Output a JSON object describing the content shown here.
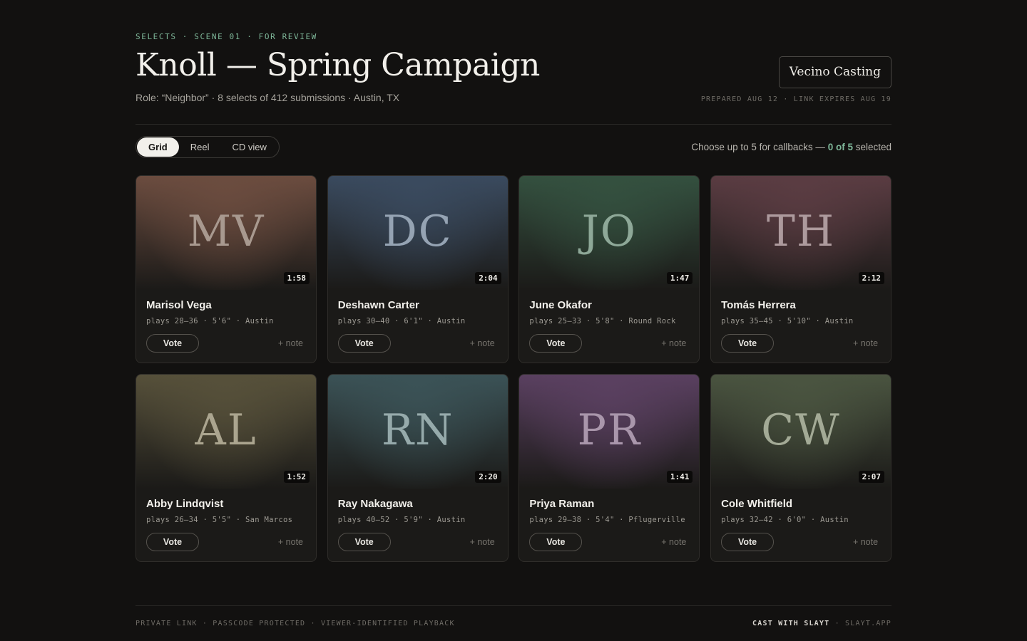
{
  "header": {
    "eyebrow": "SELECTS · SCENE 01 · FOR REVIEW",
    "title": "Knoll — Spring Campaign",
    "subtitle": "Role: “Neighbor” · 8 selects of 412 submissions · Austin, TX",
    "brand": "Vecino Casting",
    "prepared": "PREPARED AUG 12 · LINK EXPIRES AUG 19"
  },
  "toolbar": {
    "views": [
      "Grid",
      "Reel",
      "CD view"
    ],
    "active_view": "Grid",
    "callout_prefix": "Choose up to 5 for callbacks — ",
    "callout_count": "0 of 5",
    "callout_suffix": " selected"
  },
  "card_labels": {
    "vote": "Vote",
    "note": "+ note"
  },
  "talent": [
    {
      "initials": "MV",
      "name": "Marisol Vega",
      "meta": "plays 28–36 · 5'6\" · Austin",
      "duration": "1:58",
      "tint": "#6b4c3f",
      "glyph": "#a8998f"
    },
    {
      "initials": "DC",
      "name": "Deshawn Carter",
      "meta": "plays 30–40 · 6'1\" · Austin",
      "duration": "2:04",
      "tint": "#3a4a5e",
      "glyph": "#95a3b3"
    },
    {
      "initials": "JO",
      "name": "June Okafor",
      "meta": "plays 25–33 · 5'8\" · Round Rock",
      "duration": "1:47",
      "tint": "#34503f",
      "glyph": "#8ea898"
    },
    {
      "initials": "TH",
      "name": "Tomás Herrera",
      "meta": "plays 35–45 · 5'10\" · Austin",
      "duration": "2:12",
      "tint": "#5a3c42",
      "glyph": "#ad9a9d"
    },
    {
      "initials": "AL",
      "name": "Abby Lindqvist",
      "meta": "plays 26–34 · 5'5\" · San Marcos",
      "duration": "1:52",
      "tint": "#56503a",
      "glyph": "#aba58f"
    },
    {
      "initials": "RN",
      "name": "Ray Nakagawa",
      "meta": "plays 40–52 · 5'9\" · Austin",
      "duration": "2:20",
      "tint": "#3b5256",
      "glyph": "#96aaab"
    },
    {
      "initials": "PR",
      "name": "Priya Raman",
      "meta": "plays 29–38 · 5'4\" · Pflugerville",
      "duration": "1:41",
      "tint": "#5a4060",
      "glyph": "#a996ab"
    },
    {
      "initials": "CW",
      "name": "Cole Whitfield",
      "meta": "plays 32–42 · 6'0\" · Austin",
      "duration": "2:07",
      "tint": "#4a5440",
      "glyph": "#a3aa96"
    }
  ],
  "footer": {
    "left": "PRIVATE LINK · PASSCODE PROTECTED · VIEWER-IDENTIFIED PLAYBACK",
    "right_strong": "CAST WITH SLAYT",
    "right_rest": " · SLAYT.APP"
  }
}
